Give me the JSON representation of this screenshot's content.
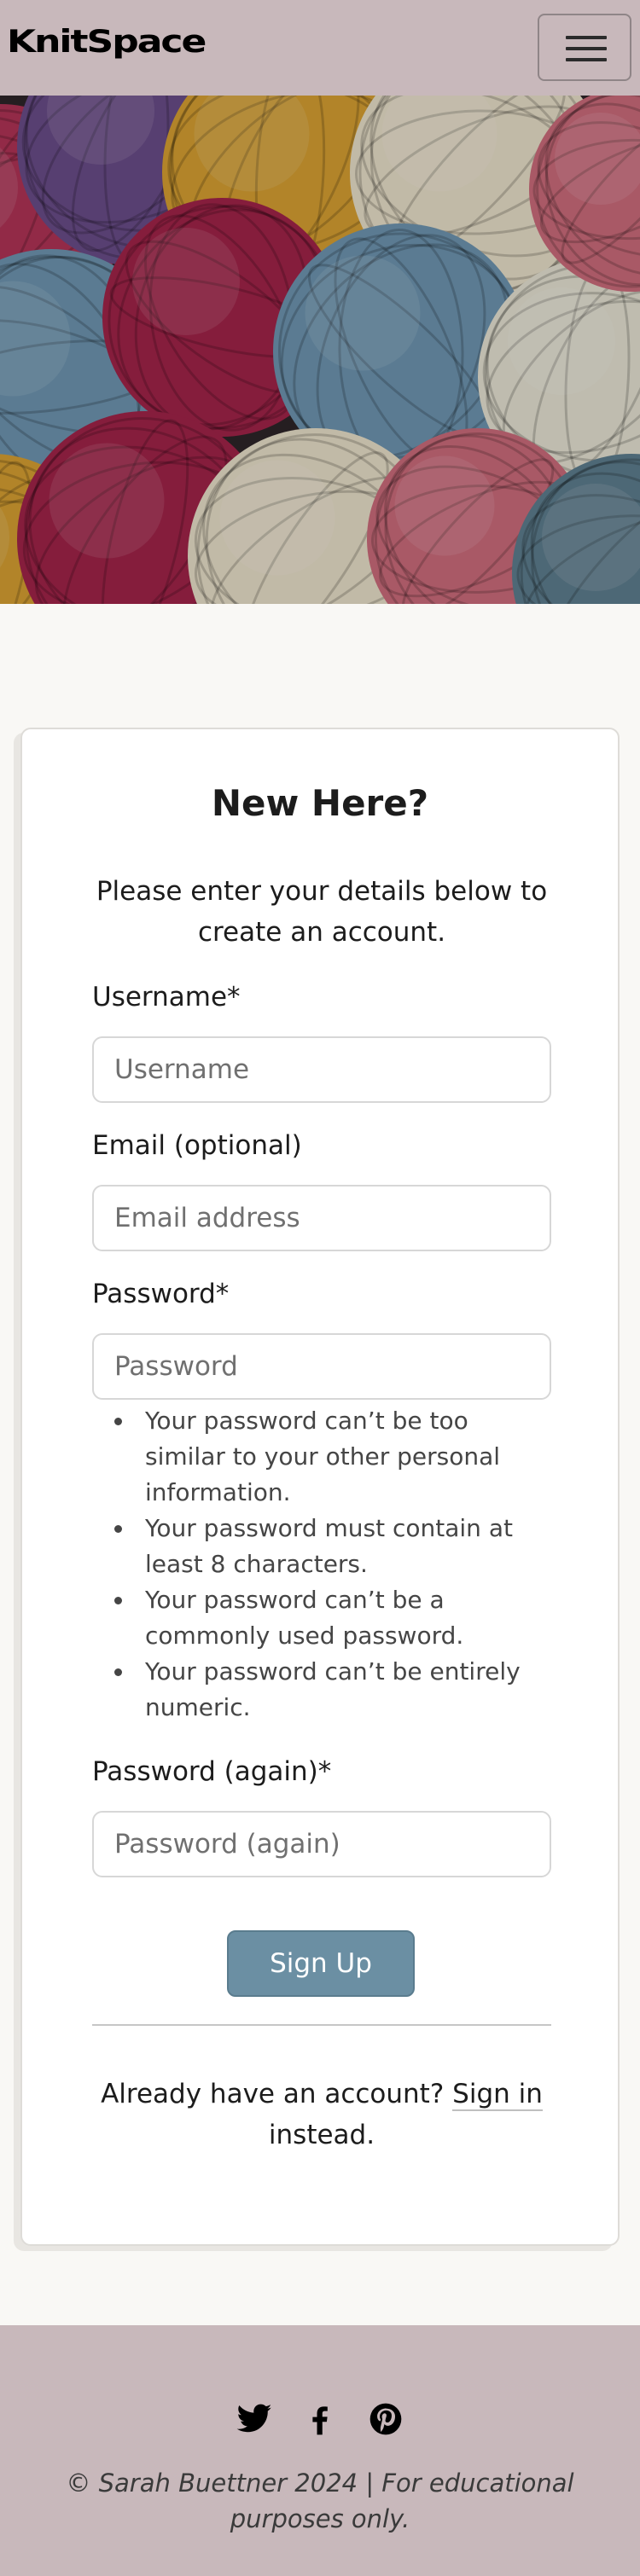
{
  "header": {
    "brand": "KnitSpace",
    "menu_icon": "hamburger-menu-icon"
  },
  "hero": {
    "image": "colorful-yarn-balls",
    "colors": [
      "#b23457",
      "#6b4d8a",
      "#d9a233",
      "#6f97b3",
      "#ece3cc",
      "#a3244a",
      "#d6c24a",
      "#5f7f90",
      "#cf6d7d",
      "#e9e6d6"
    ]
  },
  "form": {
    "title": "New Here?",
    "intro": "Please enter your details below to create an account.",
    "username": {
      "label": "Username*",
      "placeholder": "Username",
      "value": ""
    },
    "email": {
      "label": "Email (optional)",
      "placeholder": "Email address",
      "value": ""
    },
    "password": {
      "label": "Password*",
      "placeholder": "Password",
      "value": ""
    },
    "password_help": [
      "Your password can’t be too similar to your other personal information.",
      "Your password must contain at least 8 characters.",
      "Your password can’t be a commonly used password.",
      "Your password can’t be entirely numeric."
    ],
    "password2": {
      "label": "Password (again)*",
      "placeholder": "Password (again)",
      "value": ""
    },
    "submit_label": "Sign Up",
    "signin_prefix": "Already have an account?",
    "signin_link": "Sign in",
    "signin_suffix": "instead."
  },
  "footer": {
    "social_icons": [
      "twitter-icon",
      "facebook-icon",
      "pinterest-icon"
    ],
    "copyright": "© Sarah Buettner 2024 | For educational purposes only."
  },
  "colors": {
    "nav_background": "#c8b8bb",
    "page_background": "#f9f8f5",
    "button_background": "#6b8fa3"
  }
}
